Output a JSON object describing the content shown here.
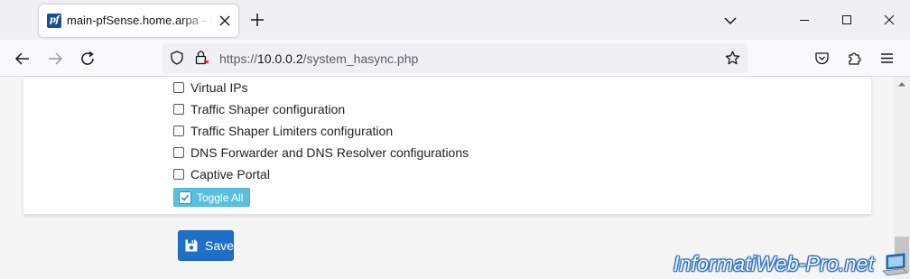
{
  "browser": {
    "tab": {
      "favicon_text": "pf",
      "title": "main-pfSense.home.arpa - System: High Avail"
    },
    "url": {
      "prefix": "https://",
      "host": "10.0.0.2",
      "path": "/system_hasync.php"
    }
  },
  "options": [
    {
      "label": "Virtual IPs",
      "checked": false
    },
    {
      "label": "Traffic Shaper configuration",
      "checked": false
    },
    {
      "label": "Traffic Shaper Limiters configuration",
      "checked": false
    },
    {
      "label": "DNS Forwarder and DNS Resolver configurations",
      "checked": false
    },
    {
      "label": "Captive Portal",
      "checked": false
    }
  ],
  "toggle_all": {
    "label": "Toggle All",
    "checked": true
  },
  "save": {
    "label": "Save"
  },
  "watermark": {
    "text": "InformatiWeb-Pro.net"
  },
  "colors": {
    "info_button": "#5bc0de",
    "primary_button": "#1e6fc7",
    "favicon_bg": "#1a4f91"
  },
  "icons": {
    "tab_close": "close-icon",
    "new_tab": "plus-icon",
    "back": "arrow-left-icon",
    "forward": "arrow-right-icon",
    "reload": "reload-icon",
    "tracking_protection": "shield-icon",
    "site_security": "lock-icon",
    "bookmark": "star-icon",
    "pocket": "pocket-icon",
    "extensions": "puzzle-icon",
    "app_menu": "hamburger-icon",
    "save": "floppy-disk-icon"
  }
}
